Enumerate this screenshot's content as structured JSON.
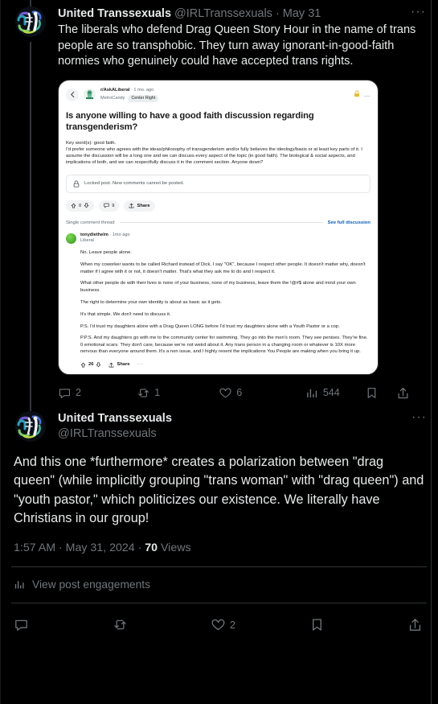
{
  "theme": {
    "bg": "#000000",
    "text": "#e7e9ea",
    "muted": "#71767b",
    "border": "#2f3336",
    "reddit_link": "#0a5dba",
    "lock_gold": "#e8b931"
  },
  "tweet1": {
    "display_name": "United Transsexuals",
    "handle": "@IRLTranssexuals",
    "separator": "·",
    "date": "May 31",
    "more_label": "···",
    "text": "The liberals who defend Drag Queen Story Hour in the name of trans people are so transphobic. They turn away ignorant-in-good-faith normies who genuinely could have accepted trans rights.",
    "metrics": {
      "replies": "2",
      "reposts": "1",
      "likes": "6",
      "views": "544"
    }
  },
  "embedded_reddit": {
    "subreddit": "r/AskALiberal",
    "age": "1 mo. ago",
    "separator": "·",
    "author": "MetroCandy",
    "flair": "Center Right",
    "title": "Is anyone willing to have a good faith discussion regarding transgenderism?",
    "body": [
      "Key word(s): good faith.",
      "I'd prefer someone who agrees with the ideas/philosophy of transgenderism and/or fully believes the ideology/basis or at least key parts of it. I assume the discussion will be a long one and we can discuss every aspect of the topic (in good faith). The biological & social aspects, and implications of both, and we can respectfully discuss it in the comment section. Anyone down?"
    ],
    "locked_notice": "Locked post. New comments cannot be posted.",
    "actions": {
      "score": "0",
      "comments": "9",
      "share": "Share"
    },
    "thread_label": "Single comment thread",
    "full_discussion_link": "See full discussion",
    "comment": {
      "author": "tonydiethelm",
      "separator": "·",
      "age": "1mo ago",
      "flair": "Liberal",
      "paragraphs": [
        "No. Leave people alone.",
        "When my coworker wants to be called Richard instead of Dick, I say \"OK\", because I respect other people. It doesn't matter why, doesn't matter if I agree with it or not, it doesn't matter. That's what they ask me to do and I respect it.",
        "What other people do with their lives is none of your business, none of my business, leave them the !@#$ alone and mind your own business.",
        "The right to determine your own identity is about as basic as it gets.",
        "It's that simple. We don't need to discuss it.",
        "P.S. I'd trust my daughters alone with a Drag Queen LONG before I'd trust my daughters alone with a Youth Pastor or a cop.",
        "P.P.S. And my daughters go with me to the community center for swimming. They go into the men's room. They see penises. They're fine. 0 emotional scars. They don't care, because we're not weird about it. Any trans person in a changing room or whatever is 10X more nervous than everyone around them. It's a non issue, and I highly resent the implications You People are making when you bring it up."
      ],
      "score": "26",
      "share": "Share",
      "more": "···"
    }
  },
  "tweet2": {
    "display_name": "United Transsexuals",
    "handle": "@IRLTranssexuals",
    "more_label": "···",
    "text": "And this one *furthermore* creates a polarization between \"drag queen\" (while implicitly grouping \"trans woman\" with \"drag queen\") and \"youth pastor,\" which politicizes our existence. We literally have Christians in our group!",
    "timestamp": "1:57 AM · May 31, 2024 · ",
    "views_count": "70",
    "views_label": " Views",
    "engagements_label": "View post engagements",
    "metrics": {
      "replies": "",
      "reposts": "",
      "likes": "2",
      "bookmarks": "",
      "share": ""
    }
  },
  "icons": {
    "reply": "reply-icon",
    "repost": "repost-icon",
    "like": "heart-icon",
    "views": "analytics-icon",
    "bookmark": "bookmark-icon",
    "share": "share-icon",
    "more": "more-horizontal-icon",
    "back": "back-arrow-icon",
    "lock": "lock-icon",
    "upvote": "upvote-arrow-icon",
    "downvote": "downvote-arrow-icon",
    "comment": "comment-bubble-icon"
  }
}
